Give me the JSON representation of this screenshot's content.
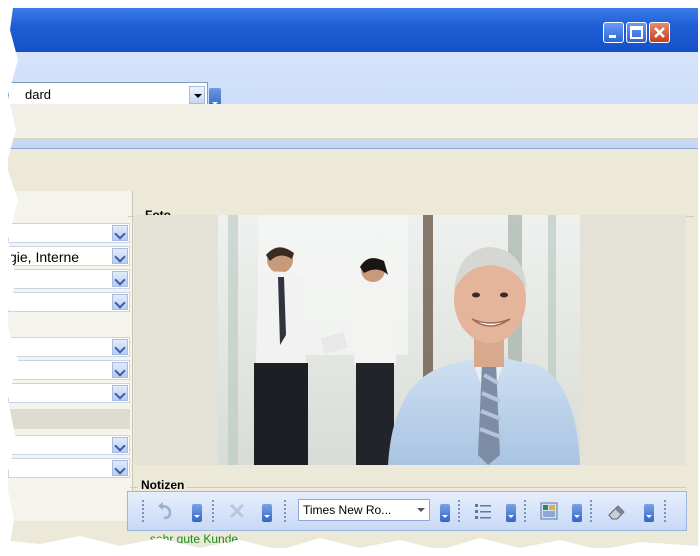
{
  "toolbar": {
    "style_combo_value": "dard"
  },
  "left_fields": [
    {
      "value": ""
    },
    {
      "value": "gie, Interne"
    },
    {
      "value": ""
    },
    {
      "value": ""
    },
    {
      "value": ""
    },
    {
      "value": ""
    },
    {
      "value": ""
    },
    {
      "value": ""
    },
    {
      "value": ""
    }
  ],
  "foto": {
    "title": "Foto"
  },
  "notizen": {
    "title": "Notizen",
    "font_name": "Times New Ro...",
    "text": "sehr gute Kunde"
  },
  "colors": {
    "titlebar": "#1e5fd6",
    "toolbar": "#c4d8f6",
    "window_bg": "#ece9d8",
    "notes_text": "#1a8a1a"
  }
}
